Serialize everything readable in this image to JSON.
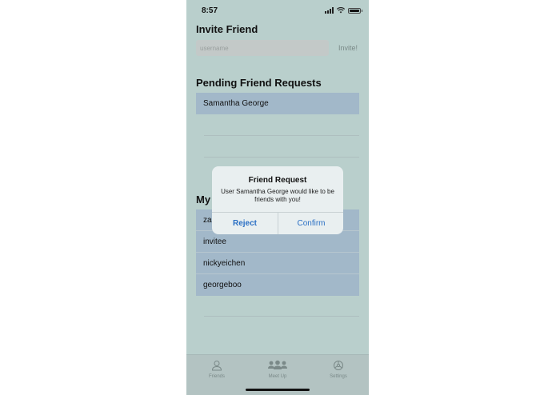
{
  "status_bar": {
    "time": "8:57",
    "icons": [
      "signal-icon",
      "wifi-icon",
      "battery-icon"
    ]
  },
  "invite": {
    "title": "Invite Friend",
    "placeholder": "username",
    "button_label": "Invite!"
  },
  "pending": {
    "title": "Pending Friend Requests",
    "items": [
      {
        "name": "Samantha George"
      }
    ]
  },
  "friends": {
    "title": "My",
    "items": [
      {
        "name": "za"
      },
      {
        "name": "invitee"
      },
      {
        "name": "nickyeichen"
      },
      {
        "name": "georgeboo"
      }
    ]
  },
  "alert": {
    "title": "Friend Request",
    "message": "User Samantha George would like to be friends with you!",
    "reject_label": "Reject",
    "confirm_label": "Confirm",
    "button_color": "#2a6fc4"
  },
  "tab_bar": {
    "tabs": [
      {
        "label": "Friends",
        "icon": "person-icon"
      },
      {
        "label": "Meet Up",
        "icon": "group-icon"
      },
      {
        "label": "Settings",
        "icon": "settings-icon"
      }
    ]
  },
  "colors": {
    "background": "#b9cfcc",
    "list_fill": "#a2b8c9"
  }
}
